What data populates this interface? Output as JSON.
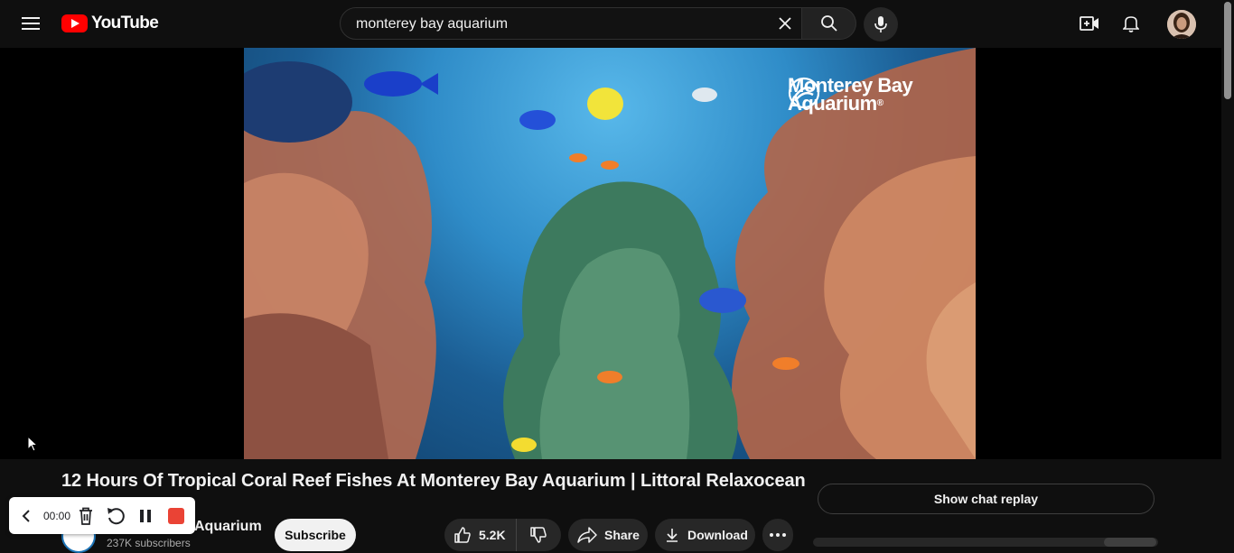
{
  "header": {
    "logo_text": "YouTube",
    "search_value": "monterey bay aquarium",
    "search_placeholder": "Search",
    "icons": [
      "menu-icon",
      "youtube-logo-icon",
      "clear-icon",
      "search-icon",
      "microphone-icon",
      "create-video-icon",
      "notifications-icon",
      "avatar"
    ]
  },
  "video": {
    "watermark_line1": "Monterey Bay",
    "watermark_line2": "Aquarium",
    "watermark_trademark": "®"
  },
  "info": {
    "title": "12 Hours Of Tropical Coral Reef Fishes At Monterey Bay Aquarium | Littoral Relaxocean",
    "channel_name": "Aquarium",
    "subscribers": "237K subscribers",
    "subscribe_label": "Subscribe",
    "likes": "5.2K",
    "share_label": "Share",
    "download_label": "Download",
    "chat_replay_label": "Show chat replay"
  },
  "recorder": {
    "time": "00:00",
    "icons": [
      "back-icon",
      "delete-icon",
      "restart-icon",
      "pause-icon",
      "stop-icon"
    ]
  },
  "colors": {
    "background": "#0f0f0f",
    "youtube_red": "#ff0000",
    "pill": "#272727",
    "recorder_stop": "#ea4335"
  }
}
